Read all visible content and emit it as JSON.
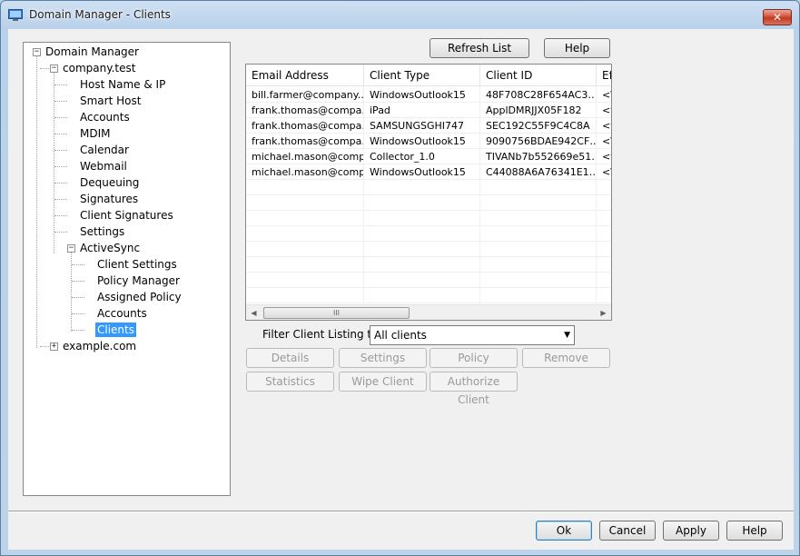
{
  "window": {
    "title": "Domain Manager - Clients",
    "close_glyph": "✕"
  },
  "tree": {
    "root": "Domain Manager",
    "domain1": "company.test",
    "domain1_items": [
      "Host Name & IP",
      "Smart Host",
      "Accounts",
      "MDIM",
      "Calendar",
      "Webmail",
      "Dequeuing",
      "Signatures",
      "Client Signatures",
      "Settings"
    ],
    "activesync": "ActiveSync",
    "activesync_items": [
      "Client Settings",
      "Policy Manager",
      "Assigned Policy",
      "Accounts",
      "Clients"
    ],
    "selected": "Clients",
    "domain2": "example.com",
    "expanded_glyph": "−",
    "collapsed_glyph": "+"
  },
  "toolbar": {
    "refresh": "Refresh List",
    "help": "Help"
  },
  "table": {
    "columns": [
      "Email Address",
      "Client Type",
      "Client ID",
      "Ef"
    ],
    "rows": [
      [
        "bill.farmer@company.…",
        "WindowsOutlook15",
        "48F708C28F654AC3…",
        "<\\"
      ],
      [
        "frank.thomas@compa…",
        "iPad",
        "ApplDMRJJX05F182",
        "<f"
      ],
      [
        "frank.thomas@compa…",
        "SAMSUNGSGHI747",
        "SEC192C55F9C4C8A",
        "<f"
      ],
      [
        "frank.thomas@compa…",
        "WindowsOutlook15",
        "9090756BDAE942CF…",
        "<\\"
      ],
      [
        "michael.mason@comp…",
        "Collector_1.0",
        "TIVANb7b552669e51…",
        "<f"
      ],
      [
        "michael.mason@comp…",
        "WindowsOutlook15",
        "C44088A6A76341E1…",
        "<\\"
      ]
    ],
    "scroll_left": "◀",
    "scroll_right": "▶",
    "thumb_grip": "III"
  },
  "filter": {
    "label": "Filter Client Listing to…",
    "value": "All clients",
    "arrow": "▼"
  },
  "actions": {
    "details": "Details",
    "settings": "Settings",
    "policy": "Policy",
    "remove": "Remove",
    "statistics": "Statistics",
    "wipe": "Wipe Client",
    "authorize": "Authorize Client"
  },
  "footer": {
    "ok": "Ok",
    "cancel": "Cancel",
    "apply": "Apply",
    "help": "Help"
  },
  "colors": {
    "selection": "#3399ff",
    "window_frame": "#bcd3ea",
    "close_button": "#c23a22"
  }
}
